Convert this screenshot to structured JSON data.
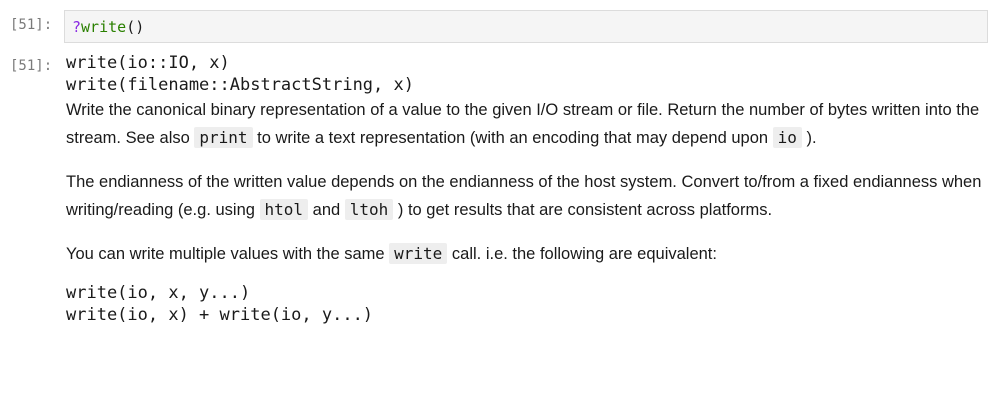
{
  "input_cell": {
    "prompt": "[51]:",
    "help_symbol": "?",
    "function_name": "write",
    "parens": "()"
  },
  "output_cell": {
    "prompt": "[51]:",
    "signatures": [
      "write(io::IO, x)",
      "write(filename::AbstractString, x)"
    ],
    "para1": {
      "text_a": "Write the canonical binary representation of a value to the given I/O stream or file. Return the number of bytes written into the stream. See also ",
      "code_print": "print",
      "text_b": " to write a text representation (with an encoding that may depend upon ",
      "code_io": "io",
      "text_c": " )."
    },
    "para2": {
      "text_a": "The endianness of the written value depends on the endianness of the host system. Convert to/from a fixed endianness when writing/reading (e.g. using ",
      "code_htol": "htol",
      "text_b": " and ",
      "code_ltoh": "ltoh",
      "text_c": " ) to get results that are consistent across platforms."
    },
    "para3": {
      "text_a": "You can write multiple values with the same ",
      "code_write": "write",
      "text_b": " call. i.e. the following are equivalent:"
    },
    "code_lines": [
      "write(io, x, y...)",
      "write(io, x) + write(io, y...)"
    ]
  }
}
